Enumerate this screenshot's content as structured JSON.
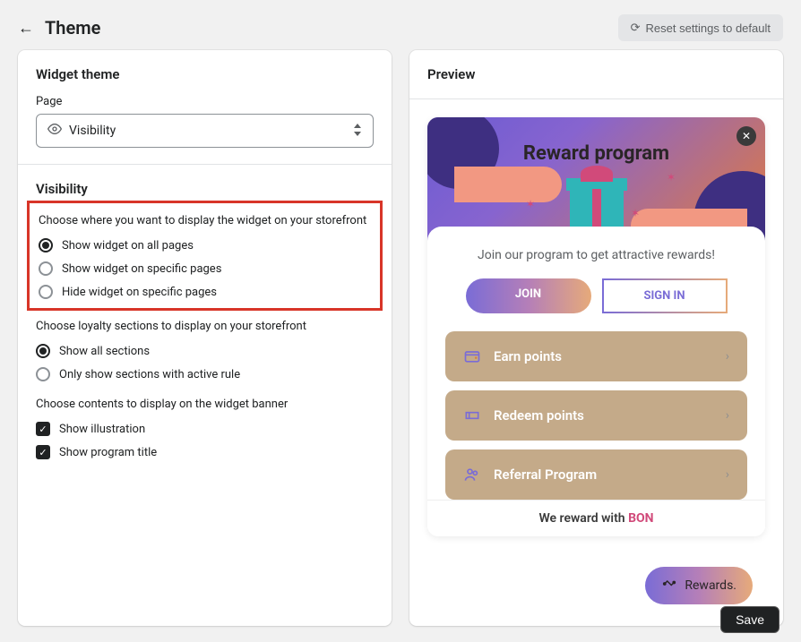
{
  "header": {
    "title": "Theme",
    "reset_label": "Reset settings to default"
  },
  "widget_theme": {
    "title": "Widget theme",
    "page_label": "Page",
    "page_value": "Visibility"
  },
  "visibility": {
    "title": "Visibility",
    "display_group_label": "Choose where you want to display the widget on your storefront",
    "display_options": {
      "all": "Show widget on all pages",
      "specific": "Show widget on specific pages",
      "hide_specific": "Hide widget on specific pages"
    },
    "display_selected": "all",
    "sections_group_label": "Choose loyalty sections to display on your storefront",
    "sections_options": {
      "all": "Show all sections",
      "active_only": "Only show sections with active rule"
    },
    "sections_selected": "all",
    "banner_group_label": "Choose contents to display on the widget banner",
    "banner_checks": {
      "illustration": {
        "label": "Show illustration",
        "checked": true
      },
      "program_title": {
        "label": "Show program title",
        "checked": true
      }
    }
  },
  "preview": {
    "title": "Preview",
    "hero_title": "Reward program",
    "tagline": "Join our program to get attractive rewards!",
    "join_label": "JOIN",
    "signin_label": "SIGN IN",
    "items": {
      "earn": "Earn points",
      "redeem": "Redeem points",
      "referral": "Referral Program"
    },
    "footer_prefix": "We reward with ",
    "footer_brand": "BON",
    "rewards_bubble": "Rewards."
  },
  "save_label": "Save"
}
